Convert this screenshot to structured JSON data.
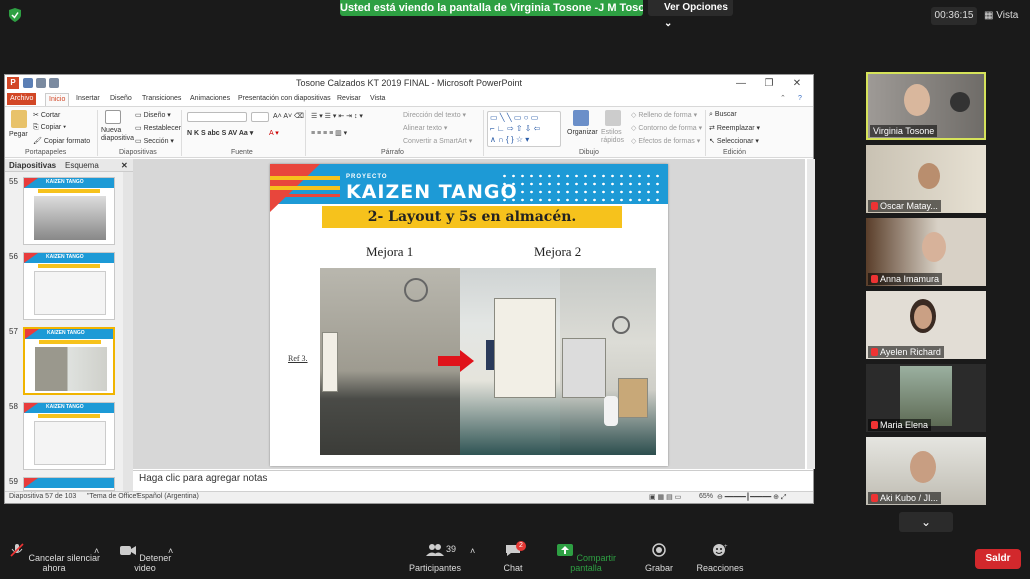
{
  "zoom": {
    "share_banner": "Usted está viendo la pantalla de Virginia Tosone -J M Tosone hi...",
    "view_options": "Ver Opciones",
    "timer": "00:36:15",
    "view_button": "Vista",
    "leave_button": "Saldr",
    "more_tiles": "⌄",
    "participants_count": "39",
    "chat_badge": "2",
    "toolbar": [
      {
        "label": "Cancelar silenciar ahora",
        "icon": "mic-muted-icon"
      },
      {
        "label": "Detener video",
        "icon": "video-camera-icon"
      },
      {
        "label": "Participantes",
        "icon": "participants-icon"
      },
      {
        "label": "Chat",
        "icon": "chat-icon"
      },
      {
        "label": "Compartir pantalla",
        "icon": "share-screen-icon"
      },
      {
        "label": "Grabar",
        "icon": "record-icon"
      },
      {
        "label": "Reacciones",
        "icon": "reactions-icon"
      }
    ],
    "participants": [
      {
        "name": "Virginia Tosone",
        "active": true
      },
      {
        "name": "Oscar Matay...",
        "active": false
      },
      {
        "name": "Anna Imamura",
        "active": false
      },
      {
        "name": "Ayelen Richard",
        "active": false
      },
      {
        "name": "Maria Elena",
        "active": false
      },
      {
        "name": "Aki Kubo / JI...",
        "active": false
      }
    ]
  },
  "ppt": {
    "title": "Tosone Calzados KT 2019 FINAL - Microsoft PowerPoint",
    "tabs": [
      "Archivo",
      "Inicio",
      "Insertar",
      "Diseño",
      "Transiciones",
      "Animaciones",
      "Presentación con diapositivas",
      "Revisar",
      "Vista"
    ],
    "ribbon": {
      "pegar": "Pegar",
      "cortar": "Cortar",
      "copiar": "Copiar",
      "copiar_formato": "Copiar formato",
      "portapapeles": "Portapapeles",
      "nueva_diapositiva": "Nueva diapositiva",
      "diseno": "Diseño",
      "restablecer": "Restablecer",
      "seccion": "Sección",
      "diapositivas": "Diapositivas",
      "fuente": "Fuente",
      "direccion_texto": "Dirección del texto",
      "alinear_texto": "Alinear texto",
      "convertir_smartart": "Convertir a SmartArt",
      "parrafo": "Párrafo",
      "organizar": "Organizar",
      "estilos_rapidos": "Estilos rápidos",
      "relleno_forma": "Relleno de forma",
      "contorno_forma": "Contorno de forma",
      "efectos_formas": "Efectos de formas",
      "dibujo": "Dibujo",
      "buscar": "Buscar",
      "reemplazar": "Reemplazar",
      "seleccionar": "Seleccionar",
      "edicion": "Edición"
    },
    "pane_tabs": [
      "Diapositivas",
      "Esquema"
    ],
    "thumbnails": [
      {
        "num": "55",
        "selected": false
      },
      {
        "num": "56",
        "selected": false
      },
      {
        "num": "57",
        "selected": true
      },
      {
        "num": "58",
        "selected": false
      },
      {
        "num": "59",
        "selected": false
      }
    ],
    "slide": {
      "proyecto": "PROYECTO",
      "kaizen": "KAIZEN TANGO",
      "subtitle": "2- Layout y 5s en almacén.",
      "mejora1": "Mejora 1",
      "mejora2": "Mejora 2",
      "ref": "Ref 3."
    },
    "notes_placeholder": "Haga clic para agregar notas",
    "status": {
      "slide_counter": "Diapositiva 57 de 103",
      "theme": "\"Tema de Office\"",
      "language": "Español (Argentina)",
      "zoom": "65%"
    }
  }
}
